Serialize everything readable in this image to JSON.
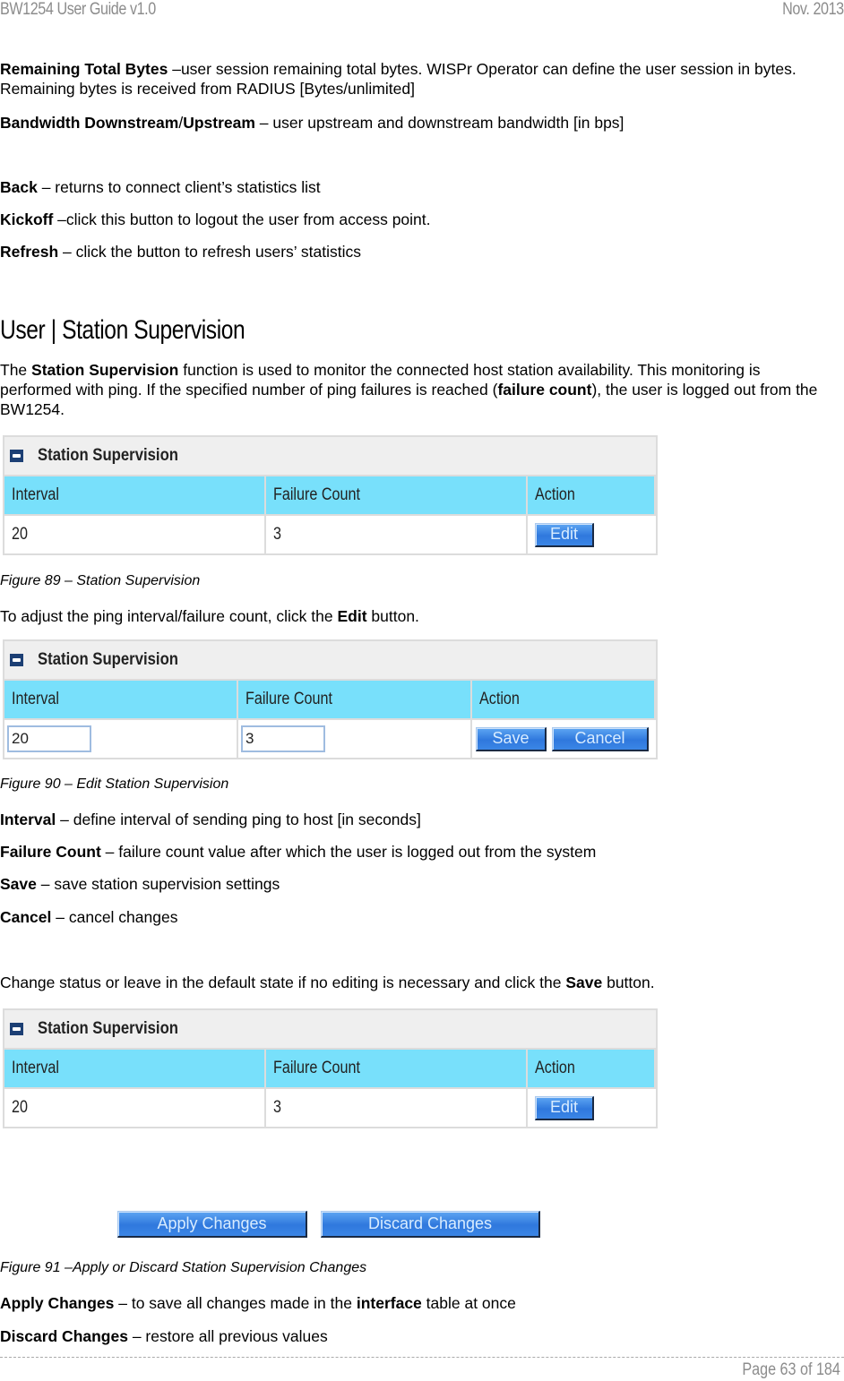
{
  "header": {
    "left": "BW1254 User Guide v1.0",
    "right": "Nov.  2013"
  },
  "intro": [
    {
      "term": "Remaining Total Bytes",
      "text": " –user session remaining total bytes. WISPr Operator can define the user session in bytes. Remaining bytes is received from RADIUS [Bytes/unlimited]"
    },
    {
      "term": "Bandwidth Downstream",
      "sep": "/",
      "term2": "Upstream",
      "text": " – user upstream and downstream bandwidth [in bps]"
    },
    {
      "term": "Back",
      "text": " – returns to connect client’s statistics list"
    },
    {
      "term": "Kickoff",
      "text": " –click this button to logout the user from access point."
    },
    {
      "term": "Refresh",
      "text": " – click the button to refresh users’ statistics"
    }
  ],
  "section_title": "User | Station Supervision",
  "section_desc": {
    "pre": "The ",
    "b1": "Station Supervision",
    "mid": " function is used to monitor the connected host station availability. This monitoring is performed with ping. If the specified number of ping failures is reached (",
    "b2": "failure count",
    "post": "), the user is logged out from the BW1254."
  },
  "panel_title": "Station Supervision",
  "columns": [
    "Interval",
    "Failure Count",
    "Action"
  ],
  "figure1": {
    "interval": "20",
    "failure_count": "3",
    "edit_label": "Edit",
    "caption": "Figure 89 – Station Supervision"
  },
  "edit_instruction": {
    "pre": "To adjust the ping interval/failure count, click the ",
    "b": "Edit",
    "post": " button."
  },
  "figure2": {
    "interval_value": "20",
    "failure_value": "3",
    "save_label": "Save",
    "cancel_label": "Cancel",
    "caption": "Figure 90 – Edit Station Supervision"
  },
  "definitions": [
    {
      "term": "Interval",
      "text": " – define interval of sending ping to host [in seconds]"
    },
    {
      "term": "Failure Count",
      "text": " – failure count value after which the user is logged out from the system"
    },
    {
      "term": "Save",
      "text": " – save station supervision settings"
    },
    {
      "term": "Cancel",
      "text": " – cancel changes"
    }
  ],
  "change_status": {
    "pre": "Change status or leave in the default state if no editing is necessary and click the ",
    "b": "Save",
    "post": " button."
  },
  "figure3": {
    "interval": "20",
    "failure_count": "3",
    "edit_label": "Edit",
    "apply_label": "Apply Changes",
    "discard_label": "Discard Changes",
    "caption": "Figure 91 –Apply or Discard Station Supervision Changes"
  },
  "final_defs": [
    {
      "term": "Apply Changes",
      "pre": " – to save all changes made in the ",
      "b": "interface",
      "post": " table at once"
    },
    {
      "term": "Discard Changes",
      "text": " – restore all previous values"
    }
  ],
  "footer": {
    "page": "Page 63 of 184"
  }
}
